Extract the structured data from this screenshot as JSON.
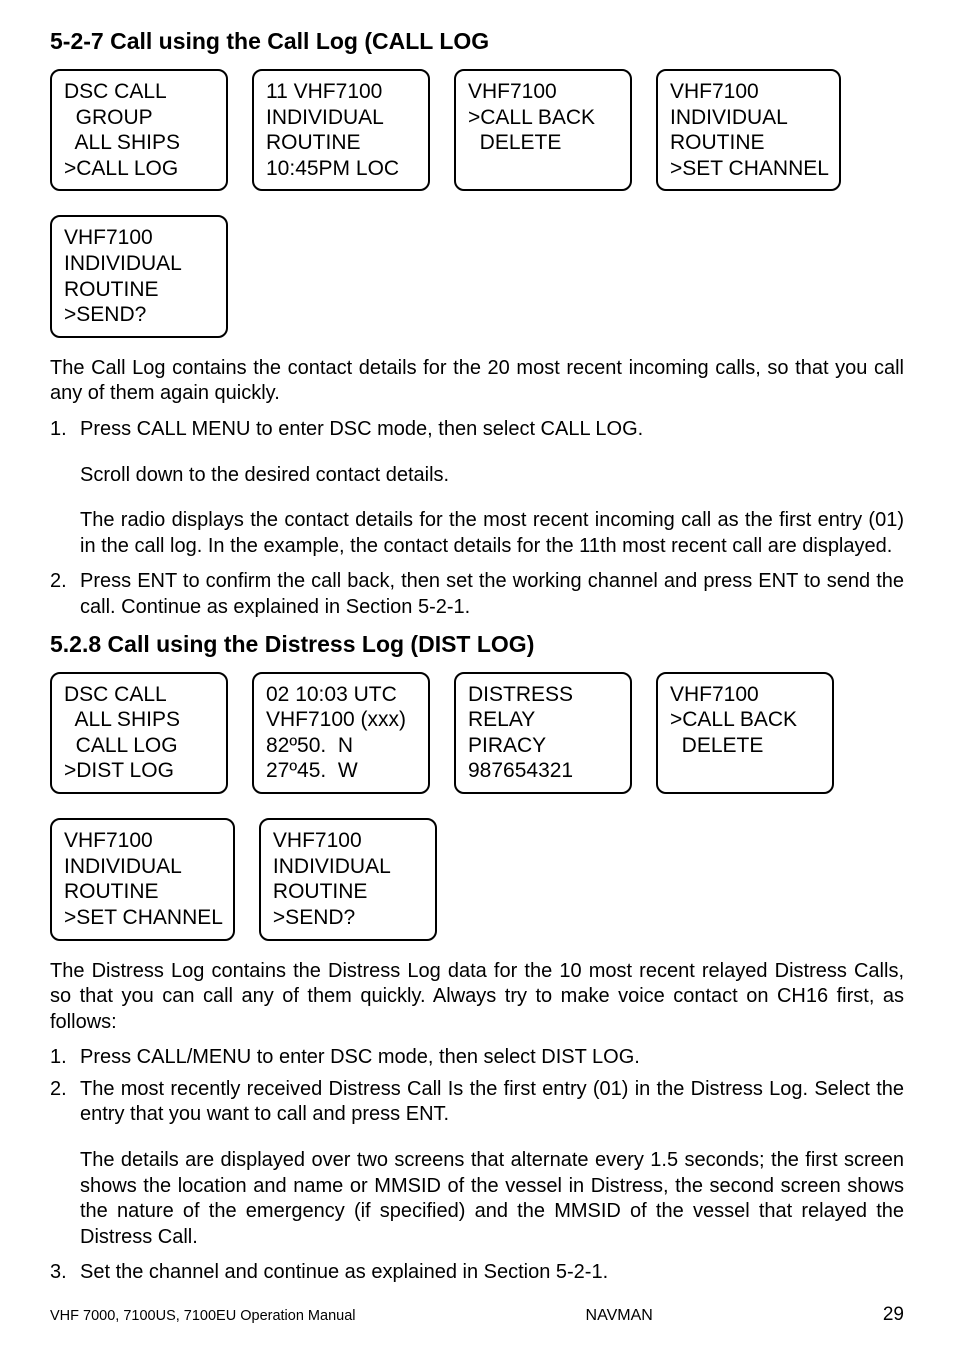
{
  "section1": {
    "heading": "5-2-7 Call using the Call Log (CALL LOG",
    "screens": [
      [
        "DSC CALL",
        "  GROUP",
        "  ALL SHIPS",
        ">CALL LOG"
      ],
      [
        "11 VHF7100",
        "INDIVIDUAL",
        "ROUTINE",
        "10:45PM LOC"
      ],
      [
        "VHF7100",
        ">CALL BACK",
        "  DELETE"
      ],
      [
        "VHF7100",
        "INDIVIDUAL",
        "ROUTINE",
        ">SET CHANNEL"
      ],
      [
        "VHF7100",
        "INDIVIDUAL",
        "ROUTINE",
        ">SEND?"
      ]
    ],
    "para1": "The Call Log contains the contact details for the 20 most recent incoming calls, so that you call any of them again quickly.",
    "step1_num": "1.",
    "step1_text": "Press CALL MENU to enter DSC mode, then select CALL LOG.",
    "step1_sub1": "Scroll down to the desired contact details.",
    "step1_sub2": "The radio displays the contact details for the most recent incoming call as the first entry (01) in the call log. In the example, the contact details for the 11th most recent call are displayed.",
    "step2_num": "2.",
    "step2_text": "Press ENT to confirm the call back, then set the working channel and press ENT to send the call. Continue as explained in Section 5-2-1."
  },
  "section2": {
    "heading": "5.2.8 Call using the Distress Log (DIST LOG)",
    "screens": [
      [
        "DSC CALL",
        "  ALL SHIPS",
        "  CALL LOG",
        ">DIST LOG"
      ],
      [
        "02 10:03 UTC",
        "VHF7100 (xxx)",
        "82º50.  N",
        "27º45.  W"
      ],
      [
        "DISTRESS",
        "RELAY",
        "PIRACY",
        "987654321"
      ],
      [
        "VHF7100",
        ">CALL BACK",
        "  DELETE"
      ],
      [
        "VHF7100",
        "INDIVIDUAL",
        "ROUTINE",
        ">SET CHANNEL"
      ],
      [
        "VHF7100",
        "INDIVIDUAL",
        "ROUTINE",
        ">SEND?"
      ]
    ],
    "para1": "The Distress Log contains the Distress Log data for the 10 most recent relayed Distress Calls, so that you can call any of them quickly. Always try to make voice contact on CH16 first, as follows:",
    "step1_num": "1.",
    "step1_text": "Press CALL/MENU to enter DSC mode, then select DIST LOG.",
    "step2_num": "2.",
    "step2_text": "The most recently received Distress Call Is the first entry (01) in the Distress Log. Select the entry that you want to call and press ENT.",
    "step2_sub1": "The details are displayed over two screens that alternate every 1.5 seconds; the first screen shows the location and name or MMSID of the vessel in Distress, the second screen shows the nature of the emergency (if specified) and the MMSID of the vessel that relayed the Distress Call.",
    "step3_num": "3.",
    "step3_text": "Set the channel and continue as explained in Section 5-2-1."
  },
  "footer": {
    "left": "VHF 7000, 7100US, 7100EU Operation Manual",
    "center": "NAVMAN",
    "right": "29"
  }
}
